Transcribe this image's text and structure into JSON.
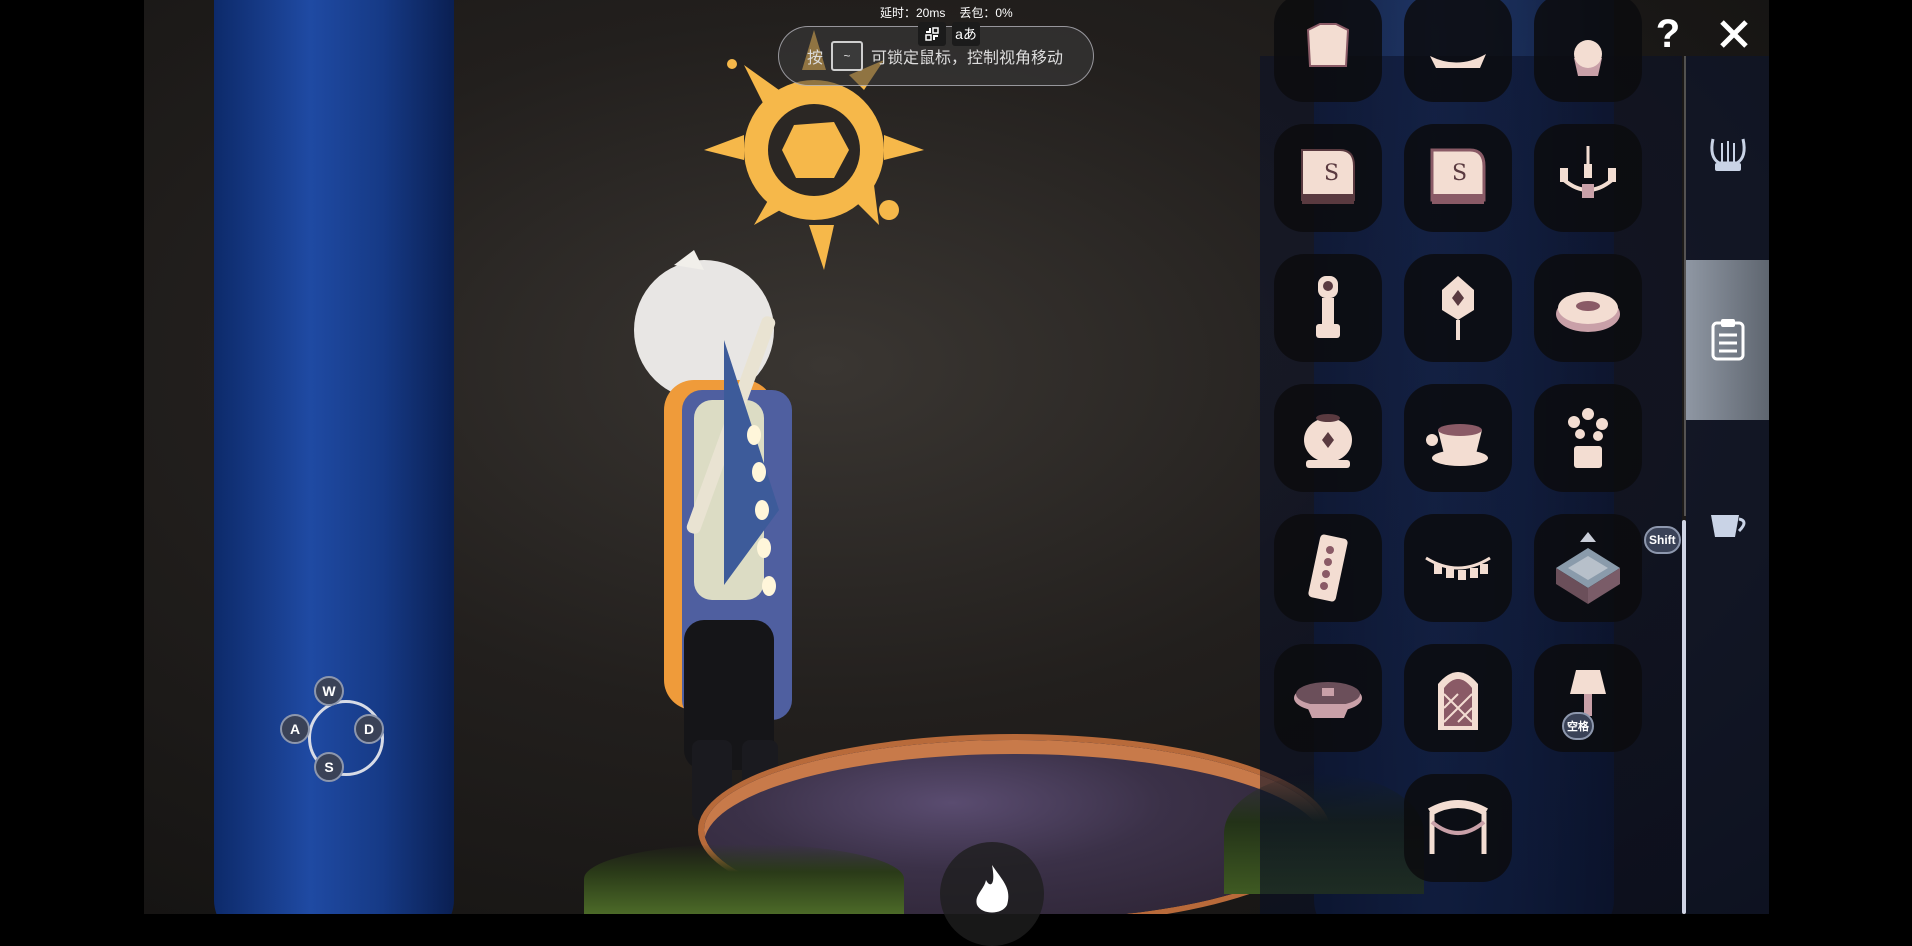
{
  "status": {
    "latency": "延时：20ms",
    "packet_loss": "丢包：0%"
  },
  "toggles": {
    "fullscreen_icon": "exit-fullscreen-icon",
    "language_icon": "translate-icon",
    "language_label": "aあ"
  },
  "hint": {
    "prefix": "按",
    "key": "~",
    "text": "可锁定鼠标，控制视角移动"
  },
  "controls": {
    "w": "W",
    "a": "A",
    "s": "S",
    "d": "D"
  },
  "panel": {
    "items": [
      {
        "name": "shirt-icon"
      },
      {
        "name": "pillow-icon"
      },
      {
        "name": "cupcake-icon"
      },
      {
        "name": "piano-icon"
      },
      {
        "name": "piano-alt-icon"
      },
      {
        "name": "chandelier-icon"
      },
      {
        "name": "grandfather-clock-icon"
      },
      {
        "name": "hanging-lantern-icon"
      },
      {
        "name": "donut-icon"
      },
      {
        "name": "vase-icon"
      },
      {
        "name": "teacup-icon"
      },
      {
        "name": "flower-box-icon"
      },
      {
        "name": "domino-icon"
      },
      {
        "name": "bunting-icon"
      },
      {
        "name": "cube-placement-icon"
      },
      {
        "name": "round-table-icon"
      },
      {
        "name": "lattice-door-icon"
      },
      {
        "name": "lamp-icon"
      },
      {
        "name": "hammock-icon"
      }
    ],
    "shift_label": "Shift",
    "space_label": "空格"
  },
  "sidebar": {
    "tabs": [
      {
        "name": "lyre-icon",
        "active": false
      },
      {
        "name": "clipboard-icon",
        "active": true
      },
      {
        "name": "teacup-icon",
        "active": false
      }
    ]
  },
  "top_right": {
    "help": "?",
    "close_icon": "close-icon"
  },
  "colors": {
    "sun": "#f6b84a",
    "pillar": "#1f4aa3",
    "icon_fill": "#f3ddd2",
    "icon_accent": "#8a5a66"
  }
}
